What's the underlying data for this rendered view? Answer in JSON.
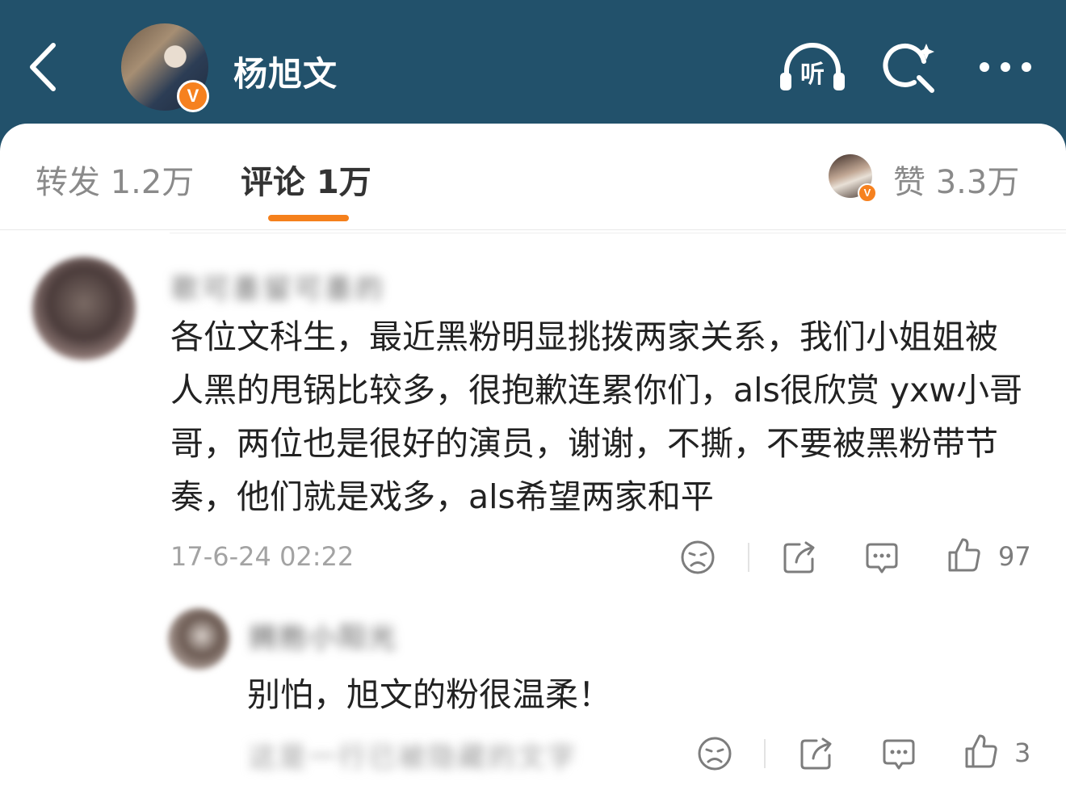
{
  "header": {
    "username": "杨旭文",
    "listen_icon_label": "听",
    "colors": {
      "background": "#22516b",
      "badge": "#f6811f"
    }
  },
  "tabs": {
    "repost": "转发 1.2万",
    "comments": "评论 1万",
    "likes": "赞 3.3万",
    "verified_badge": "V"
  },
  "comment": {
    "author": "歌可墨留可墨的",
    "text": "各位文科生，最近黑粉明显挑拨两家关系，我们小姐姐被人黑的甩锅比较多，很抱歉连累你们，als很欣赏 yxw小哥哥，两位也是很好的演员，谢谢，不撕，不要被黑粉带节奏，他们就是戏多，als希望两家和平",
    "timestamp": "17-6-24 02:22",
    "like_count": "97"
  },
  "reply": {
    "author": "拥抱小阳光",
    "text": "别怕，旭文的粉很温柔！",
    "like_count": "3",
    "hidden_line": "这是一行已被隐藏的文字"
  }
}
